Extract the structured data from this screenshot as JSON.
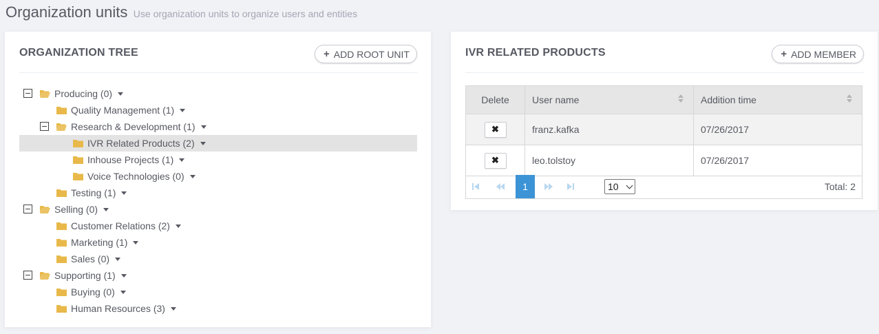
{
  "page": {
    "title": "Organization units",
    "subtitle": "Use organization units to organize users and entities"
  },
  "tree_panel": {
    "title": "ORGANIZATION TREE",
    "add_root_label": "ADD ROOT UNIT",
    "nodes": [
      {
        "label": "Producing (0)",
        "level": 0,
        "expanded": true
      },
      {
        "label": "Quality Management (1)",
        "level": 1,
        "expanded": false
      },
      {
        "label": "Research & Development (1)",
        "level": 1,
        "expanded": true
      },
      {
        "label": "IVR Related Products (2)",
        "level": 2,
        "expanded": false,
        "selected": true
      },
      {
        "label": "Inhouse Projects (1)",
        "level": 2,
        "expanded": false
      },
      {
        "label": "Voice Technologies (0)",
        "level": 2,
        "expanded": false
      },
      {
        "label": "Testing (1)",
        "level": 1,
        "expanded": false
      },
      {
        "label": "Selling (0)",
        "level": 0,
        "expanded": true
      },
      {
        "label": "Customer Relations (2)",
        "level": 1,
        "expanded": false
      },
      {
        "label": "Marketing (1)",
        "level": 1,
        "expanded": false
      },
      {
        "label": "Sales (0)",
        "level": 1,
        "expanded": false
      },
      {
        "label": "Supporting (1)",
        "level": 0,
        "expanded": true
      },
      {
        "label": "Buying (0)",
        "level": 1,
        "expanded": false
      },
      {
        "label": "Human Resources (3)",
        "level": 1,
        "expanded": false
      }
    ]
  },
  "members_panel": {
    "title": "IVR RELATED PRODUCTS",
    "add_member_label": "ADD MEMBER",
    "columns": [
      "Delete",
      "User name",
      "Addition time"
    ],
    "rows": [
      {
        "user": "franz.kafka",
        "time": "07/26/2017"
      },
      {
        "user": "leo.tolstoy",
        "time": "07/26/2017"
      }
    ],
    "delete_glyph": "✖",
    "pager": {
      "current_page": "1",
      "page_size": "10",
      "total": "Total: 2",
      "icons": {
        "first": "first-page-icon",
        "prev": "previous-page-icon",
        "next": "next-page-icon",
        "last": "last-page-icon"
      }
    }
  },
  "colors": {
    "accent": "#3c93d6",
    "folder": "#e8b94a",
    "selected_row": "#e3e3e3",
    "background": "#f1f2f6"
  }
}
